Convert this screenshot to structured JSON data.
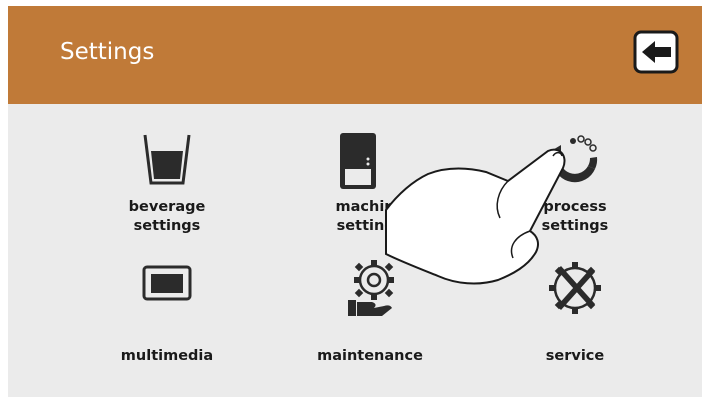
{
  "header": {
    "title": "Settings",
    "back_icon": "back-arrow-icon"
  },
  "tiles": [
    {
      "line1": "beverage",
      "line2": "settings",
      "icon": "glass-icon"
    },
    {
      "line1": "machine",
      "line2": "settings",
      "icon": "machine-icon"
    },
    {
      "line1": "process",
      "line2": "settings",
      "icon": "process-cycle-icon"
    },
    {
      "line1": "multimedia",
      "line2": "",
      "icon": "screen-icon"
    },
    {
      "line1": "maintenance",
      "line2": "",
      "icon": "gear-hand-icon"
    },
    {
      "line1": "service",
      "line2": "",
      "icon": "wrench-screwdriver-icon"
    }
  ],
  "colors": {
    "header": "#c07a38",
    "background": "#ebebeb",
    "icon": "#2b2b2b"
  }
}
